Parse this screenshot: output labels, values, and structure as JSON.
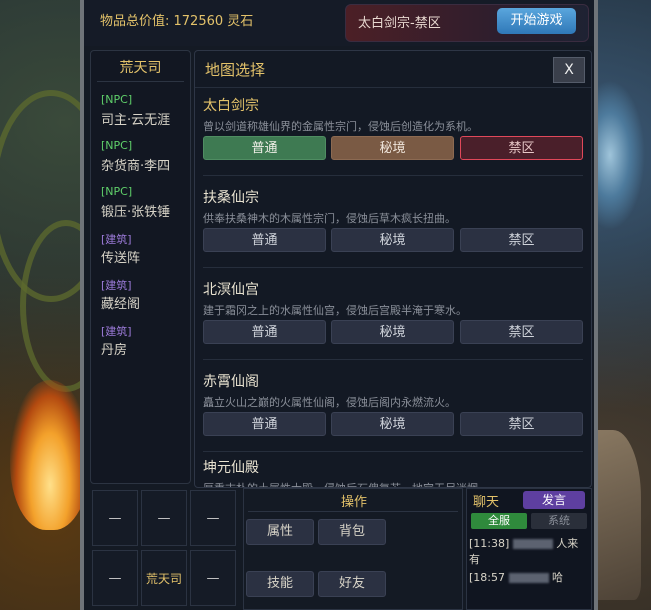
{
  "top": {
    "total_value_label": "物品总价值: 172560 灵石",
    "stage_text": "太白剑宗-禁区",
    "start_button": "开始游戏"
  },
  "left_panel": {
    "title": "荒天司",
    "items": [
      {
        "tag": "[NPC]",
        "name": "司主·云无涯",
        "kind": "npc"
      },
      {
        "tag": "[NPC]",
        "name": "杂货商·李四",
        "kind": "npc"
      },
      {
        "tag": "[NPC]",
        "name": "锻压·张铁锤",
        "kind": "npc"
      },
      {
        "tag": "[建筑]",
        "name": "传送阵",
        "kind": "building"
      },
      {
        "tag": "[建筑]",
        "name": "藏经阁",
        "kind": "building"
      },
      {
        "tag": "[建筑]",
        "name": "丹房",
        "kind": "building"
      }
    ]
  },
  "map_dialog": {
    "title": "地图选择",
    "close_label": "X",
    "sections": [
      {
        "name": "太白剑宗",
        "desc": "曾以剑道称雄仙界的金属性宗门，侵蚀后创造化为系机。",
        "buttons": [
          "普通",
          "秘境",
          "禁区"
        ],
        "selected": "禁区",
        "active": true
      },
      {
        "name": "扶桑仙宗",
        "desc": "供奉扶桑神木的木属性宗门，侵蚀后草木疯长扭曲。",
        "buttons": [
          "普通",
          "秘境",
          "禁区"
        ],
        "active": false
      },
      {
        "name": "北溟仙宫",
        "desc": "建于霜冈之上的水属性仙宫，侵蚀后宫殿半淹于寒水。",
        "buttons": [
          "普通",
          "秘境",
          "禁区"
        ],
        "active": false
      },
      {
        "name": "赤霄仙阁",
        "desc": "矗立火山之巅的火属性仙阁，侵蚀后阁内永燃流火。",
        "buttons": [
          "普通",
          "秘境",
          "禁区"
        ],
        "active": false
      },
      {
        "name": "坤元仙殿",
        "desc": "厚重古朴的土属性大殿，侵蚀后石傀复苏，地宫无尽迷惘。",
        "buttons": [],
        "active": false
      }
    ]
  },
  "slots": [
    "—",
    "—",
    "—",
    "—",
    "荒天司",
    "—"
  ],
  "ops": {
    "title": "操作",
    "buttons": [
      "属性",
      "背包",
      "技能",
      "好友"
    ]
  },
  "chat": {
    "title": "聊天",
    "speak_button": "发言",
    "tabs": [
      "全服",
      "系统"
    ],
    "messages": [
      {
        "time": "[11:38]",
        "suffix": "人来"
      },
      {
        "time": "",
        "suffix": "有"
      },
      {
        "time": "[18:57",
        "suffix": "哈"
      }
    ]
  },
  "colors": {
    "gold": "#e3c26a",
    "npc_green": "#5fcf6a",
    "building_purple": "#9b7ad8",
    "selected_red": "#e0485a"
  }
}
